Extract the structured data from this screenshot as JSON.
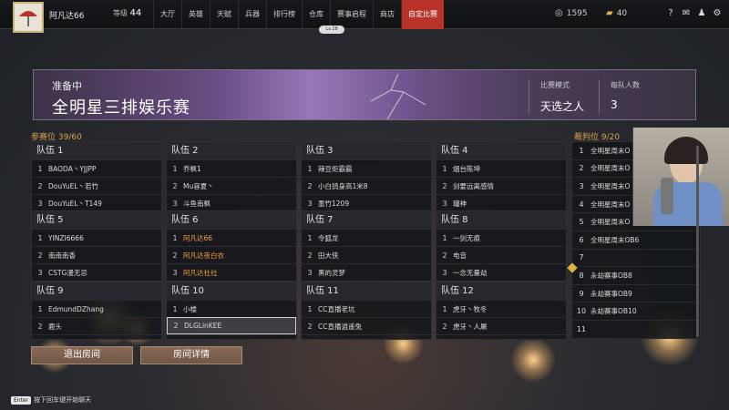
{
  "topbar": {
    "username": "阿凡达66",
    "level_label": "等级",
    "level": "44",
    "nav": [
      "大厅",
      "英雄",
      "天赋",
      "兵器",
      "排行榜",
      "仓库",
      "赛事启程",
      "商店",
      "自定比赛"
    ],
    "active_nav": "自定比赛",
    "lv_badge": "Lv.28",
    "currency1": "1595",
    "currency2": "40",
    "colors": {
      "active": "#b8322a",
      "accent": "#e0a24a"
    }
  },
  "banner": {
    "status": "准备中",
    "title": "全明星三排娱乐赛",
    "mode_label": "比赛模式",
    "mode_value": "天选之人",
    "team_size_label": "每队人数",
    "team_size_value": "3"
  },
  "participants_label": "参赛位",
  "participants_count": "39/60",
  "referee_label": "裁判位",
  "referee_count": "9/20",
  "teams": [
    {
      "name": "队伍 1",
      "players": [
        "BAODA丶YJJPP",
        "DouYuEL丶若竹",
        "DouYuEL丶T149"
      ]
    },
    {
      "name": "队伍 2",
      "players": [
        "乔枫1",
        "Mu容夏丶",
        "斗鱼南枫"
      ]
    },
    {
      "name": "队伍 3",
      "players": [
        "辣豆炬霸霸",
        "小白鸽身高1米8",
        "墨竹1209"
      ]
    },
    {
      "name": "队伍 4",
      "players": [
        "烟台陈坤",
        "剑要远离感情",
        "瓏神"
      ]
    },
    {
      "name": "队伍 5",
      "players": [
        "YINZI6666",
        "南南南香",
        "CSTG漫无忌"
      ]
    },
    {
      "name": "队伍 6",
      "players": [
        "阿凡达66",
        "阿凡达夜白衣",
        "阿凡达社社"
      ]
    },
    {
      "name": "队伍 7",
      "players": [
        "令狐龙",
        "田大侠",
        "黑的灵梦"
      ]
    },
    {
      "name": "队伍 8",
      "players": [
        "一剑无痕",
        "电音",
        "一念无量劫"
      ]
    },
    {
      "name": "队伍 9",
      "players": [
        "EdmundDZhang",
        "鹿头",
        ""
      ]
    },
    {
      "name": "队伍 10",
      "players": [
        "小楼",
        "DLGLinKEE",
        ""
      ]
    },
    {
      "name": "队伍 11",
      "players": [
        "CC直播老坑",
        "CC直播逍遥兔",
        ""
      ]
    },
    {
      "name": "队伍 12",
      "players": [
        "虎牙丶牧冬",
        "虎牙丶人屠",
        ""
      ]
    }
  ],
  "referees": [
    "全明星周末O",
    "全明星周末O",
    "全明星周末O",
    "全明星周末O",
    "全明星周末O",
    "全明星周末OB6",
    "",
    "永劫赛事OB8",
    "永劫赛事OB9",
    "永劫赛事OB10",
    ""
  ],
  "buttons": {
    "exit": "退出房间",
    "details": "房间详情"
  },
  "chat_hint": {
    "key": "Enter",
    "text": "按下回车键开始聊天"
  }
}
